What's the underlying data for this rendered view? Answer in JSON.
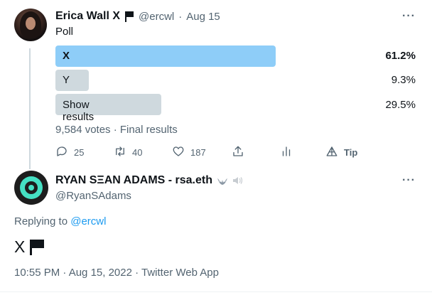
{
  "tweet": {
    "author_name": "Erica Wall X",
    "author_handle": "@ercwl",
    "separator": "·",
    "date": "Aug 15",
    "more": "···",
    "text": "Poll",
    "poll": {
      "options": [
        {
          "label": "X",
          "percent": "61.2%",
          "fraction": 0.612
        },
        {
          "label": "Y",
          "percent": "9.3%",
          "fraction": 0.093
        },
        {
          "label": "Show results",
          "percent": "29.5%",
          "fraction": 0.295
        }
      ],
      "summary": "9,584 votes · Final results"
    },
    "actions": {
      "replies": "25",
      "retweets": "40",
      "likes": "187",
      "tip": "Tip"
    }
  },
  "reply": {
    "author_name": "RYAN SΞAN ADAMS - rsa.eth",
    "author_handle": "@RyanSAdams",
    "more": "···",
    "replying_prefix": "Replying to",
    "replying_to": "@ercwl",
    "text": "X",
    "timestamp": "10:55 PM · Aug 15, 2022 · Twitter Web App"
  },
  "colors": {
    "winner_bar": "#8ecdf8",
    "other_bar": "#cfd9de",
    "accent": "#1d9bf0",
    "secondary_text": "#536471"
  },
  "icons": [
    "flag-icon",
    "reply-icon",
    "retweet-icon",
    "like-icon",
    "share-icon",
    "analytics-icon",
    "tip-icon",
    "bat-icon",
    "speaker-icon"
  ]
}
